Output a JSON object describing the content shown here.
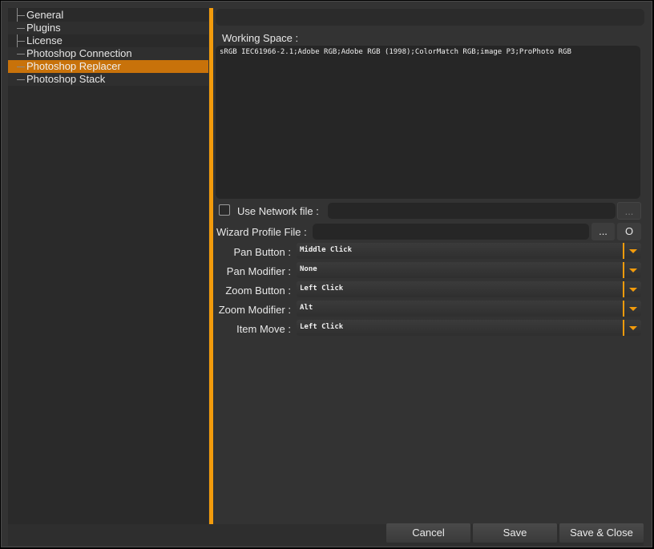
{
  "tree": {
    "items": [
      {
        "label": "General"
      },
      {
        "label": "Plugins"
      },
      {
        "label": "License"
      },
      {
        "label": "Photoshop Connection"
      },
      {
        "label": "Photoshop Replacer"
      },
      {
        "label": "Photoshop Stack"
      }
    ],
    "selected": "Photoshop Replacer"
  },
  "working_space": {
    "label": "Working Space :",
    "value": "sRGB IEC61966-2.1;Adobe RGB;Adobe RGB (1998);ColorMatch RGB;image P3;ProPhoto RGB"
  },
  "network": {
    "label": "Use Network file :",
    "checked": false,
    "value": "",
    "browse_label": "..."
  },
  "wizard": {
    "label": "Wizard Profile File :",
    "value": "",
    "browse_label": "...",
    "open_label": "O"
  },
  "settings": [
    {
      "label": "Pan Button :",
      "value": "Middle Click"
    },
    {
      "label": "Pan Modifier :",
      "value": "None"
    },
    {
      "label": "Zoom Button :",
      "value": "Left Click"
    },
    {
      "label": "Zoom Modifier :",
      "value": "Alt"
    },
    {
      "label": "Item Move :",
      "value": "Left Click"
    }
  ],
  "footer": {
    "cancel": "Cancel",
    "save": "Save",
    "save_close": "Save & Close"
  },
  "colors": {
    "accent": "#f29b0c",
    "selection": "#c8720a"
  }
}
